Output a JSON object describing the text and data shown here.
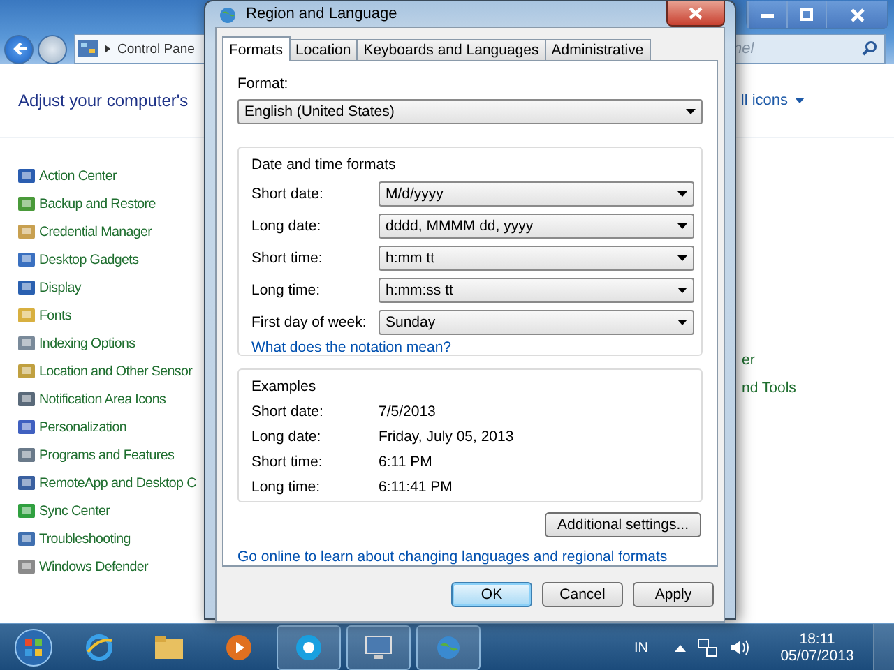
{
  "control_panel": {
    "address": "Control Pane",
    "search_placeholder": "nel",
    "heading": "Adjust your computer's",
    "view_by": "ll icons",
    "items": [
      {
        "label": "Action Center"
      },
      {
        "label": "Backup and Restore"
      },
      {
        "label": "Credential Manager"
      },
      {
        "label": "Desktop Gadgets"
      },
      {
        "label": "Display"
      },
      {
        "label": "Fonts"
      },
      {
        "label": "Indexing Options"
      },
      {
        "label": "Location and Other Sensor"
      },
      {
        "label": "Notification Area Icons"
      },
      {
        "label": "Personalization"
      },
      {
        "label": "Programs and Features"
      },
      {
        "label": "RemoteApp and Desktop C"
      },
      {
        "label": "Sync Center"
      },
      {
        "label": "Troubleshooting"
      },
      {
        "label": "Windows Defender"
      }
    ],
    "right_items": [
      "er",
      "nd Tools"
    ]
  },
  "dialog": {
    "title": "Region and Language",
    "tabs": [
      {
        "label": "Formats",
        "selected": true
      },
      {
        "label": "Location",
        "selected": false
      },
      {
        "label": "Keyboards and Languages",
        "selected": false
      },
      {
        "label": "Administrative",
        "selected": false
      }
    ],
    "format_label": "Format:",
    "format_value": "English (United States)",
    "group_title": "Date and time formats",
    "fields": [
      {
        "label": "Short date:",
        "value": "M/d/yyyy"
      },
      {
        "label": "Long date:",
        "value": "dddd, MMMM dd, yyyy"
      },
      {
        "label": "Short time:",
        "value": "h:mm tt"
      },
      {
        "label": "Long time:",
        "value": "h:mm:ss tt"
      },
      {
        "label": "First day of week:",
        "value": "Sunday"
      }
    ],
    "notation_link": "What does the notation mean?",
    "examples_title": "Examples",
    "examples": [
      {
        "label": "Short date:",
        "value": "7/5/2013"
      },
      {
        "label": "Long date:",
        "value": "Friday, July 05, 2013"
      },
      {
        "label": "Short time:",
        "value": "6:11 PM"
      },
      {
        "label": "Long time:",
        "value": "6:11:41 PM"
      }
    ],
    "additional_button": "Additional settings...",
    "online_link": "Go online to learn about changing languages and regional formats",
    "buttons": [
      {
        "label": "OK",
        "default": true
      },
      {
        "label": "Cancel",
        "default": false
      },
      {
        "label": "Apply",
        "default": false
      }
    ]
  },
  "taskbar": {
    "language": "IN",
    "time": "18:11",
    "date": "05/07/2013"
  }
}
